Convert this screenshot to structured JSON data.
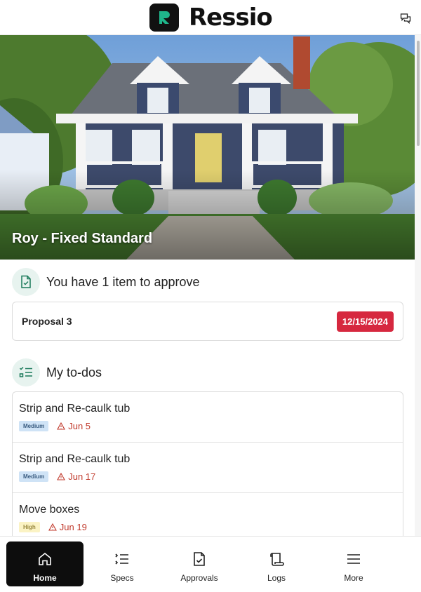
{
  "app": {
    "brand": "Ressio"
  },
  "project": {
    "title": "Roy - Fixed Standard"
  },
  "approvals": {
    "heading": "You have 1 item to approve",
    "items": [
      {
        "name": "Proposal 3",
        "date": "12/15/2024"
      }
    ]
  },
  "todos": {
    "heading": "My to-dos",
    "items": [
      {
        "title": "Strip and Re-caulk tub",
        "priority": "Medium",
        "due": "Jun 5"
      },
      {
        "title": "Strip and Re-caulk tub",
        "priority": "Medium",
        "due": "Jun 17"
      },
      {
        "title": "Move boxes",
        "priority": "High",
        "due": "Jun 19"
      }
    ]
  },
  "nav": {
    "items": [
      {
        "label": "Home",
        "icon": "home-icon",
        "active": true
      },
      {
        "label": "Specs",
        "icon": "list-icon",
        "active": false
      },
      {
        "label": "Approvals",
        "icon": "document-check-icon",
        "active": false
      },
      {
        "label": "Logs",
        "icon": "scroll-icon",
        "active": false
      },
      {
        "label": "More",
        "icon": "menu-icon",
        "active": false
      }
    ]
  },
  "colors": {
    "accent": "#1fb58a",
    "danger": "#d6283f",
    "nav_active": "#0d0d0d"
  }
}
